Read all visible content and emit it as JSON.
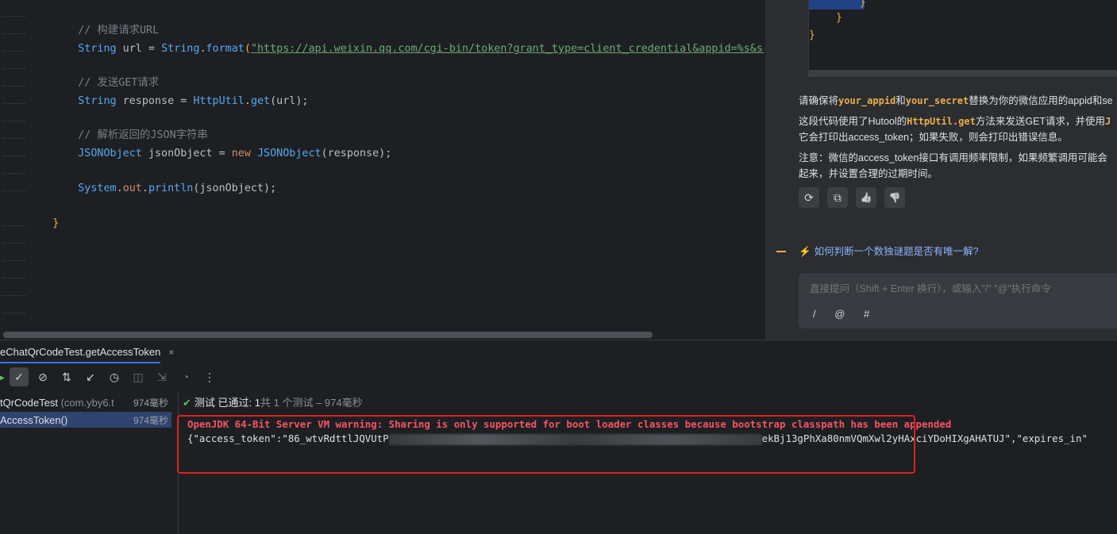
{
  "editor": {
    "lines": {
      "comment_build_url": "// 构建请求URL",
      "url_decl_type": "String",
      "url_decl_var": " url = ",
      "url_decl_call_type": "String",
      "url_decl_dot": ".",
      "url_decl_fn": "format",
      "url_decl_paren": "(",
      "url_string": "\"https://api.weixin.qq.com/cgi-bin/token?grant_type=client_credential&appid=%s&secret=%s\"",
      "comment_send_get": "// 发送GET请求",
      "resp_type": "String",
      "resp_var": " response = ",
      "resp_class": "HttpUtil",
      "resp_dot": ".",
      "resp_fn": "get",
      "resp_args": "(url);",
      "comment_parse_json": "// 解析返回的JSON字符串",
      "json_type": "JSONObject",
      "json_var": " jsonObject = ",
      "json_new": "new",
      "json_class": " JSONObject",
      "json_args": "(response);",
      "print_system": "System",
      "print_dot1": ".",
      "print_out": "out",
      "print_dot2": ".",
      "print_fn": "println",
      "print_args": "(jsonObject);",
      "closing_brace": "}"
    }
  },
  "ai_panel": {
    "code_box": {
      "brace1": "}",
      "brace2": "}"
    },
    "para1": {
      "before": "请确保将",
      "h1": "your_appid",
      "mid": "和",
      "h2": "your_secret",
      "after": "替换为你的微信应用的appid和se"
    },
    "para2": {
      "before": "这段代码使用了Hutool的",
      "h1": "HttpUtil.get",
      "after": "方法来发送GET请求，并使用",
      "tail": "J"
    },
    "para2b": "它会打印出access_token；如果失败，则会打印出错误信息。",
    "para3": "注意：微信的access_token接口有调用频率限制，如果频繁调用可能会",
    "para3b": "起来，并设置合理的过期时间。",
    "actions": [
      {
        "icon": "refresh-icon",
        "glyph": "⟳"
      },
      {
        "icon": "copy-icon",
        "glyph": "⧉"
      },
      {
        "icon": "thumbs-up-icon",
        "glyph": "👍"
      },
      {
        "icon": "thumbs-down-icon",
        "glyph": "👎"
      }
    ],
    "suggestion": "如何判断一个数独谜题是否有唯一解?",
    "suggestion_icon": "⚡",
    "input_placeholder": "直接提问（Shift + Enter 换行），或输入\"/\" \"@\"执行命令",
    "tools": "/ @ #"
  },
  "run_panel": {
    "tab_label": "eChatQrCodeTest.getAccessToken",
    "tab_close": "×",
    "toolbar": [
      {
        "name": "rerun-icon",
        "glyph": "▶",
        "active": false
      },
      {
        "name": "show-passed-icon",
        "glyph": "✓",
        "active": true
      },
      {
        "name": "show-ignored-icon",
        "glyph": "⊘",
        "active": false
      },
      {
        "name": "sort-icon",
        "glyph": "⇅",
        "active": false
      },
      {
        "name": "collapse-icon",
        "glyph": "↙",
        "active": false
      },
      {
        "name": "history-icon",
        "glyph": "◷",
        "active": false
      },
      {
        "name": "screenshot-icon",
        "glyph": "◫",
        "active": false,
        "dim": true
      },
      {
        "name": "import-icon",
        "glyph": "⇲",
        "active": false,
        "dim": true
      },
      {
        "name": "coverage-icon",
        "glyph": "◔",
        "active": false,
        "dim": true
      },
      {
        "name": "more-icon",
        "glyph": "⋮",
        "active": false
      }
    ],
    "tree": [
      {
        "name": "tQrCodeTest",
        "pkg": " (com.yby6.t",
        "time": "974毫秒",
        "selected": false
      },
      {
        "name": "AccessToken()",
        "pkg": "",
        "time": "974毫秒",
        "selected": true
      }
    ],
    "status": {
      "check": "✔",
      "label": "测试 已通过: ",
      "passed": "1",
      "detail": "共 1 个测试 – 974毫秒"
    },
    "console": {
      "warning": "OpenJDK 64-Bit Server VM warning: Sharing is only supported for boot loader classes because bootstrap classpath has been appended",
      "json_prefix": "{\"access_token\":\"86_wtvRdttlJQVUtP",
      "json_suffix": "ekBj13gPhXa80nmVQmXwl2yHAxciYDoHIXgAHATUJ\",\"expires_in\""
    }
  }
}
